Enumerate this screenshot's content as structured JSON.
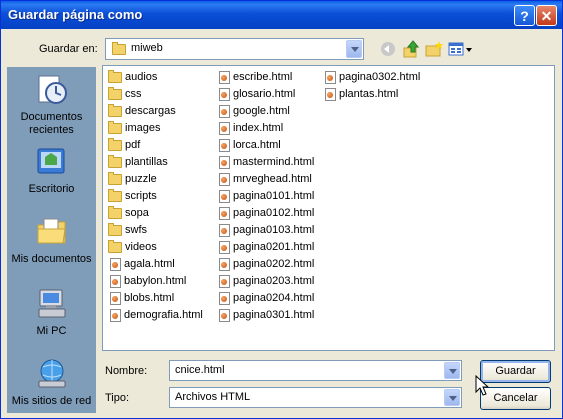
{
  "window": {
    "title": "Guardar página como"
  },
  "titlebar": {
    "help": "?",
    "close": "✕"
  },
  "save_in": {
    "label": "Guardar en:",
    "value": "miweb"
  },
  "places": [
    {
      "label": "Documentos recientes",
      "icon": "recent-documents-icon"
    },
    {
      "label": "Escritorio",
      "icon": "desktop-icon"
    },
    {
      "label": "Mis documentos",
      "icon": "my-documents-icon"
    },
    {
      "label": "Mi PC",
      "icon": "my-computer-icon"
    },
    {
      "label": "Mis sitios de red",
      "icon": "network-places-icon"
    }
  ],
  "files": {
    "col1": [
      {
        "name": "audios",
        "type": "folder"
      },
      {
        "name": "css",
        "type": "folder"
      },
      {
        "name": "descargas",
        "type": "folder"
      },
      {
        "name": "images",
        "type": "folder"
      },
      {
        "name": "pdf",
        "type": "folder"
      },
      {
        "name": "plantillas",
        "type": "folder"
      },
      {
        "name": "puzzle",
        "type": "folder"
      },
      {
        "name": "scripts",
        "type": "folder"
      },
      {
        "name": "sopa",
        "type": "folder"
      },
      {
        "name": "swfs",
        "type": "folder"
      },
      {
        "name": "videos",
        "type": "folder"
      },
      {
        "name": "agala.html",
        "type": "html"
      },
      {
        "name": "babylon.html",
        "type": "html"
      },
      {
        "name": "blobs.html",
        "type": "html"
      },
      {
        "name": "demografia.html",
        "type": "html"
      }
    ],
    "col2": [
      {
        "name": "escribe.html",
        "type": "html"
      },
      {
        "name": "glosario.html",
        "type": "html"
      },
      {
        "name": "google.html",
        "type": "html"
      },
      {
        "name": "index.html",
        "type": "html"
      },
      {
        "name": "lorca.html",
        "type": "html"
      },
      {
        "name": "mastermind.html",
        "type": "html"
      },
      {
        "name": "mrveghead.html",
        "type": "html"
      },
      {
        "name": "pagina0101.html",
        "type": "html"
      },
      {
        "name": "pagina0102.html",
        "type": "html"
      },
      {
        "name": "pagina0103.html",
        "type": "html"
      },
      {
        "name": "pagina0201.html",
        "type": "html"
      },
      {
        "name": "pagina0202.html",
        "type": "html"
      },
      {
        "name": "pagina0203.html",
        "type": "html"
      },
      {
        "name": "pagina0204.html",
        "type": "html"
      },
      {
        "name": "pagina0301.html",
        "type": "html"
      }
    ],
    "col3": [
      {
        "name": "pagina0302.html",
        "type": "html"
      },
      {
        "name": "plantas.html",
        "type": "html"
      }
    ]
  },
  "filename": {
    "label": "Nombre:",
    "value": "cnice.html"
  },
  "filetype": {
    "label": "Tipo:",
    "value": "Archivos HTML"
  },
  "buttons": {
    "save": "Guardar",
    "cancel": "Cancelar"
  }
}
